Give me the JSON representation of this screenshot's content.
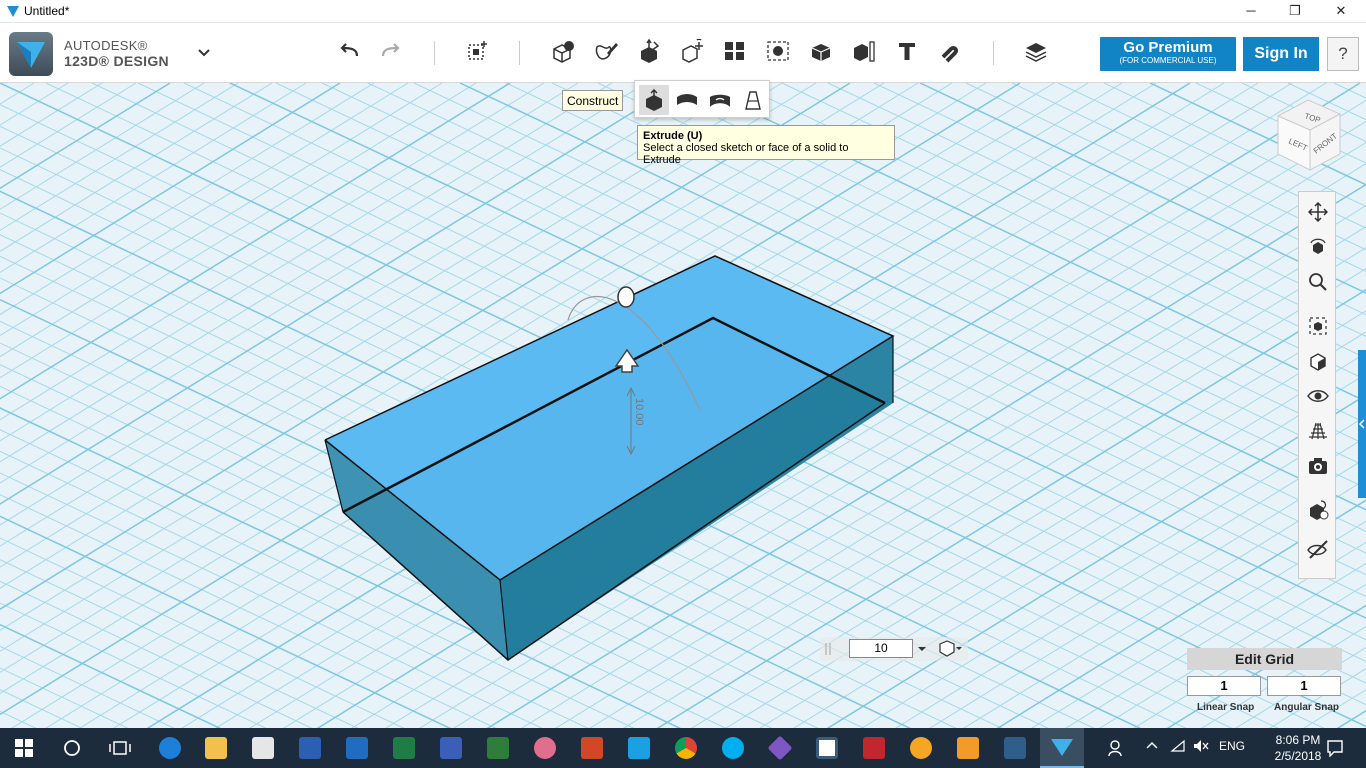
{
  "window": {
    "title": "Untitled*",
    "minimize": "─",
    "maximize": "❐",
    "close": "✕"
  },
  "brand": {
    "line1": "AUTODESK®",
    "line2": "123D® DESIGN"
  },
  "toolbar": {
    "premium_label": "Go Premium",
    "premium_sub": "(FOR COMMERCIAL USE)",
    "signin_label": "Sign In",
    "help_label": "?"
  },
  "tooltips": {
    "construct": "Construct",
    "extrude_title": "Extrude (U)",
    "extrude_desc": "Select a closed sketch or face of a solid to Extrude"
  },
  "viewcube": {
    "top": "TOP",
    "left": "LEFT",
    "front": "FRONT"
  },
  "dimension": {
    "value": "10.00"
  },
  "snap": {
    "value": "10"
  },
  "grid": {
    "edit_label": "Edit Grid",
    "linear_value": "1",
    "angular_value": "1",
    "linear_label": "Linear Snap",
    "angular_label": "Angular Snap"
  },
  "taskbar": {
    "lang": "ENG",
    "time": "8:06 PM",
    "date": "2/5/2018"
  },
  "colors": {
    "accent": "#1184c6",
    "solid_top": "#5dbcf7",
    "solid_side": "#2f8fae",
    "grid_line": "#a5d8ec",
    "taskbar": "#1c2c3c"
  }
}
